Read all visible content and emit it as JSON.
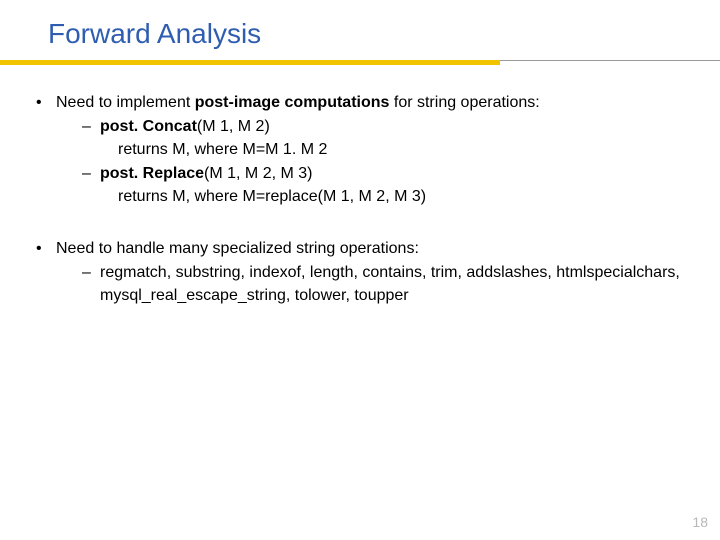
{
  "title": "Forward Analysis",
  "bullet1": {
    "lead": "Need to implement ",
    "emph": "post-image computations",
    "tail": " for string operations:",
    "item1": {
      "head": "post. Concat",
      "args": "(M 1, M 2)",
      "ret": "returns M, where M=M 1. M 2"
    },
    "item2": {
      "head": "post. Replace",
      "args": "(M 1, M 2, M 3)",
      "ret": "returns M, where M=replace(M 1, M 2, M 3)"
    }
  },
  "bullet2": {
    "lead": "Need to handle many specialized string operations:",
    "item1": "regmatch, substring, indexof, length, contains, trim, addslashes, htmlspecialchars, mysql_real_escape_string,  tolower, toupper"
  },
  "page": "18"
}
